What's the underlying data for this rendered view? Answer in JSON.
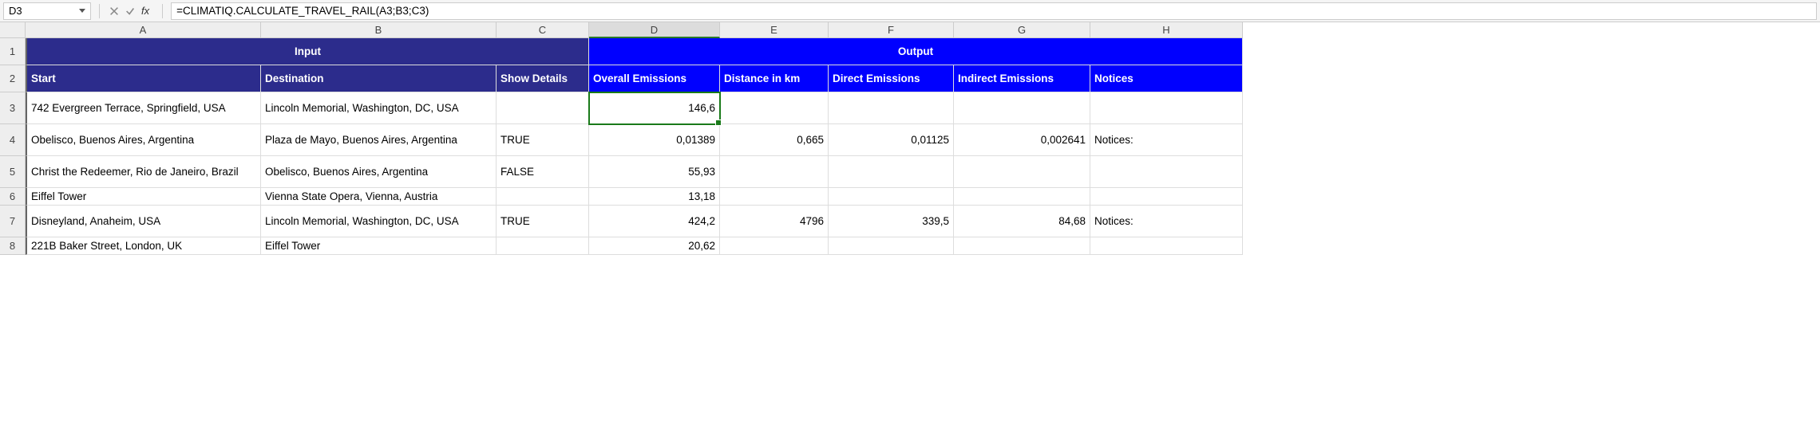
{
  "formula_bar": {
    "name_box": "D3",
    "fx_label": "fx",
    "formula": "=CLIMATIQ.CALCULATE_TRAVEL_RAIL(A3;B3;C3)"
  },
  "columns": [
    "A",
    "B",
    "C",
    "D",
    "E",
    "F",
    "G",
    "H"
  ],
  "row_numbers": [
    "1",
    "2",
    "3",
    "4",
    "5",
    "6",
    "7",
    "8"
  ],
  "headers": {
    "input": "Input",
    "output": "Output",
    "start": "Start",
    "destination": "Destination",
    "show_details": "Show Details",
    "overall_emissions": "Overall Emissions",
    "distance": "Distance in km",
    "direct_emissions": "Direct Emissions",
    "indirect_emissions": "Indirect Emissions",
    "notices": "Notices"
  },
  "rows": [
    {
      "start": "742 Evergreen Terrace, Springfield, USA",
      "destination": "Lincoln Memorial, Washington, DC, USA",
      "show_details": "",
      "overall": "146,6",
      "distance": "",
      "direct": "",
      "indirect": "",
      "notices": ""
    },
    {
      "start": "Obelisco, Buenos Aires, Argentina",
      "destination": "Plaza de Mayo, Buenos Aires, Argentina",
      "show_details": "TRUE",
      "overall": "0,01389",
      "distance": "0,665",
      "direct": "0,01125",
      "indirect": "0,002641",
      "notices": "Notices:"
    },
    {
      "start": "Christ the Redeemer, Rio de Janeiro, Brazil",
      "destination": "Obelisco, Buenos Aires, Argentina",
      "show_details": "FALSE",
      "overall": "55,93",
      "distance": "",
      "direct": "",
      "indirect": "",
      "notices": ""
    },
    {
      "start": "Eiffel Tower",
      "destination": "Vienna State Opera, Vienna, Austria",
      "show_details": "",
      "overall": "13,18",
      "distance": "",
      "direct": "",
      "indirect": "",
      "notices": ""
    },
    {
      "start": "Disneyland, Anaheim, USA",
      "destination": "Lincoln Memorial, Washington, DC, USA",
      "show_details": "TRUE",
      "overall": "424,2",
      "distance": "4796",
      "direct": "339,5",
      "indirect": "84,68",
      "notices": "Notices:"
    },
    {
      "start": "221B Baker Street, London, UK",
      "destination": "Eiffel Tower",
      "show_details": "",
      "overall": "20,62",
      "distance": "",
      "direct": "",
      "indirect": "",
      "notices": ""
    }
  ],
  "selected_column": "D"
}
